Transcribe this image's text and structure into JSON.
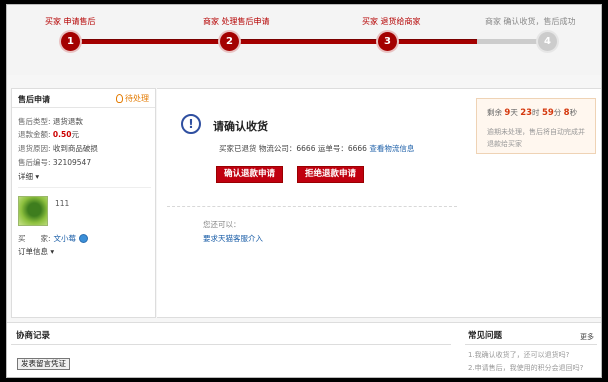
{
  "progress": {
    "steps": [
      {
        "label": "买家 申请售后",
        "num": "1"
      },
      {
        "label": "商家 处理售后申请",
        "num": "2"
      },
      {
        "label": "买家 退货给商家",
        "num": "3"
      },
      {
        "label": "商家 确认收货，售后成功",
        "num": "4"
      }
    ]
  },
  "left": {
    "title": "售后申请",
    "status": "待处理",
    "type_key": "售后类型:",
    "type_val": "退货退款",
    "amount_key": "退款金额:",
    "amount_val": "0.50",
    "amount_unit": "元",
    "reason_key": "退货原因:",
    "reason_val": "收到商品破损",
    "id_key": "售后编号:",
    "id_val": "32109547",
    "detail": "详细 ▾",
    "avatar_num": "111",
    "buyer_key": "买　　家:",
    "buyer_name": "文小莓",
    "order_info": "订单信息 ▾"
  },
  "center": {
    "title": "请确认收货",
    "ship_prefix": "买家已退货 物流公司：6666 运单号：6666",
    "ship_link": "查看物流信息",
    "confirm_btn": "确认退款申请",
    "reject_btn": "拒绝退款申请",
    "can": "您还可以：",
    "service_link": "要求天猫客服介入"
  },
  "right": {
    "timer_prefix": "剩余",
    "days": "9",
    "days_unit": "天",
    "hours": "23",
    "hours_unit": "时",
    "mins": "59",
    "mins_unit": "分",
    "secs": "8",
    "secs_unit": "秒",
    "note": "逾期未处理，售后将自动完成并退款给买家"
  },
  "bottom": {
    "negotiation_title": "协商记录",
    "proof_btn": "发表留言凭证",
    "faq_title": "常见问题",
    "faq_more": "更多",
    "faq_items": [
      "1.我确认收货了，还可以退货吗?",
      "2.申请售后，我使用的积分会退回吗?"
    ]
  }
}
